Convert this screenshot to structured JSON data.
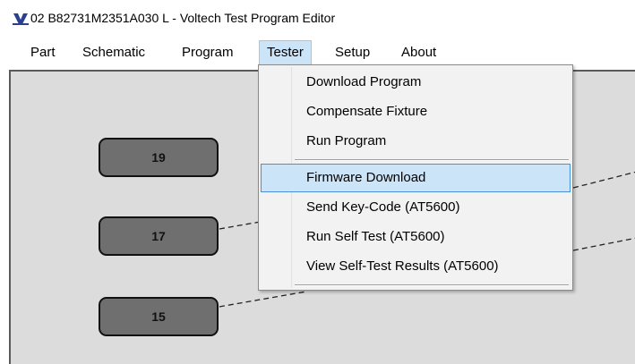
{
  "window": {
    "title": "02 B82731M2351A030 L - Voltech Test Program Editor",
    "icon": "voltech-app-icon"
  },
  "menubar": {
    "items": [
      {
        "label": "Part"
      },
      {
        "label": "Schematic"
      },
      {
        "label": "Program"
      },
      {
        "label": "Tester",
        "open": true
      },
      {
        "label": "Setup"
      },
      {
        "label": "About"
      }
    ]
  },
  "tester_menu": {
    "groups": [
      [
        "Download Program",
        "Compensate Fixture",
        "Run Program"
      ],
      [
        "Firmware Download",
        "Send Key-Code (AT5600)",
        "Run Self Test (AT5600)",
        "View Self-Test Results (AT5600)"
      ]
    ],
    "highlighted": "Firmware Download"
  },
  "schematic": {
    "pins": [
      {
        "label": "19"
      },
      {
        "label": "17"
      },
      {
        "label": "15"
      }
    ]
  },
  "colors": {
    "canvas": "#dcdcdc",
    "pin_fill": "#6f6f6f",
    "menu_highlight": "#cce4f7",
    "menu_highlight_border": "#4a90d9"
  }
}
